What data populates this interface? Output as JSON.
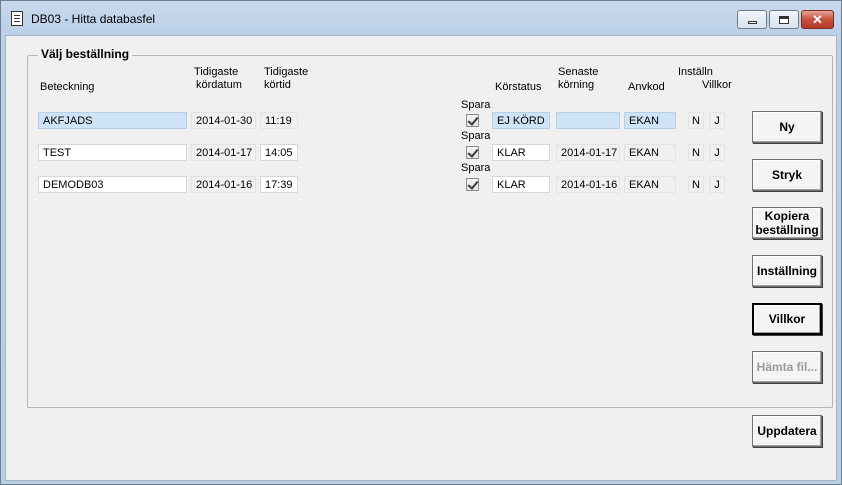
{
  "window": {
    "title": "DB03 - Hitta databasfel",
    "minimize_glyph": "",
    "close_glyph": "✕"
  },
  "group": {
    "legend": "Välj beställning"
  },
  "headers": {
    "beteckning": "Beteckning",
    "tidigaste_kordatum_1": "Tidigaste",
    "tidigaste_kordatum_2": "kördatum",
    "tidigaste_kortid_1": "Tidigaste",
    "tidigaste_kortid_2": "körtid",
    "korstatus": "Körstatus",
    "senaste_korning_1": "Senaste",
    "senaste_korning_2": "körning",
    "anvkod": "Anvkod",
    "installn": "Inställn",
    "villkor": "Villkor"
  },
  "rows": [
    {
      "spara_label": "Spara",
      "beteckning": "AKFJADS",
      "kordatum": "2014-01-30",
      "kortid": "11:19",
      "spara_checked": true,
      "korstatus": "EJ KÖRD",
      "senaste": "",
      "anvkod": "EKAN",
      "installn": "N",
      "villkor": "J",
      "selected": true
    },
    {
      "spara_label": "Spara",
      "beteckning": "TEST",
      "kordatum": "2014-01-17",
      "kortid": "14:05",
      "spara_checked": true,
      "korstatus": "KLAR",
      "senaste": "2014-01-17",
      "anvkod": "EKAN",
      "installn": "N",
      "villkor": "J",
      "selected": false
    },
    {
      "spara_label": "Spara",
      "beteckning": "DEMODB03",
      "kordatum": "2014-01-16",
      "kortid": "17:39",
      "spara_checked": true,
      "korstatus": "KLAR",
      "senaste": "2014-01-16",
      "anvkod": "EKAN",
      "installn": "N",
      "villkor": "J",
      "selected": false
    }
  ],
  "buttons": {
    "ny": "Ny",
    "stryk": "Stryk",
    "kopiera_1": "Kopiera",
    "kopiera_2": "beställning",
    "installning": "Inställning",
    "villkor": "Villkor",
    "hamta_fil": "Hämta fil...",
    "uppdatera": "Uppdatera"
  }
}
